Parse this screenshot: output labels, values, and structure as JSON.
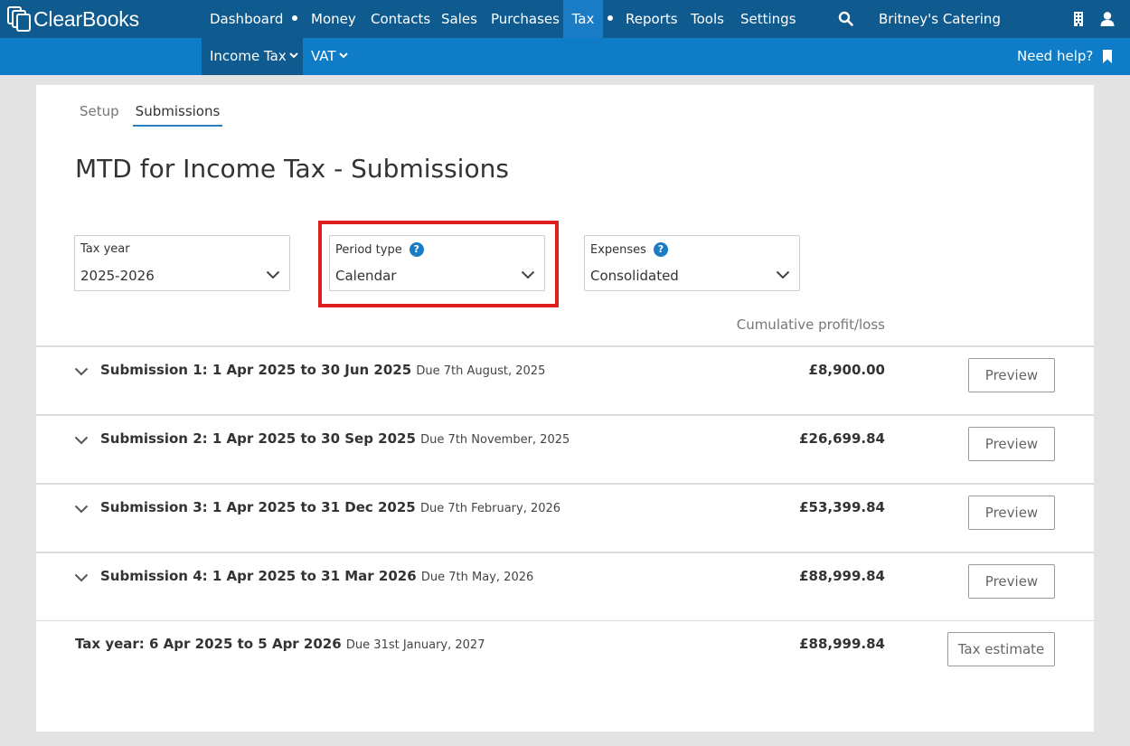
{
  "app": {
    "brand": "ClearBooks",
    "colors": {
      "nav": "#0f5a8e",
      "subnav": "#0f7cc7",
      "active": "#1a7cc4",
      "highlight": "#e02020"
    }
  },
  "topnav": {
    "items": [
      "Dashboard",
      "Money",
      "Contacts",
      "Sales",
      "Purchases",
      "Tax",
      "Reports",
      "Tools",
      "Settings"
    ],
    "active": "Tax",
    "company": "Britney's Catering",
    "icons": [
      "search-icon",
      "building-icon",
      "user-icon"
    ]
  },
  "subnav": {
    "items": [
      "Income Tax",
      "VAT"
    ],
    "active": "Income Tax",
    "help_link": "Need help?",
    "icons": [
      "bookmark-icon"
    ]
  },
  "tabs": [
    "Setup",
    "Submissions"
  ],
  "active_tab": "Submissions",
  "page_title": "MTD for Income Tax - Submissions",
  "filters": {
    "tax_year": {
      "label": "Tax year",
      "value": "2025-2026"
    },
    "period_type": {
      "label": "Period type",
      "value": "Calendar"
    },
    "expenses": {
      "label": "Expenses",
      "value": "Consolidated"
    }
  },
  "column_header": "Cumulative profit/loss",
  "submissions": [
    {
      "title": "Submission 1: 1 Apr 2025 to 30 Jun 2025",
      "due": "Due 7th August, 2025",
      "amount": "£8,900.00",
      "button": "Preview"
    },
    {
      "title": "Submission 2: 1 Apr 2025 to 30 Sep 2025",
      "due": "Due 7th November, 2025",
      "amount": "£26,699.84",
      "button": "Preview"
    },
    {
      "title": "Submission 3: 1 Apr 2025 to 31 Dec 2025",
      "due": "Due 7th February, 2026",
      "amount": "£53,399.84",
      "button": "Preview"
    },
    {
      "title": "Submission 4: 1 Apr 2025 to 31 Mar 2026",
      "due": "Due 7th May, 2026",
      "amount": "£88,999.84",
      "button": "Preview"
    }
  ],
  "tax_year_row": {
    "title": "Tax year: 6 Apr 2025 to 5 Apr 2026",
    "due": "Due 31st January, 2027",
    "amount": "£88,999.84",
    "button": "Tax estimate"
  }
}
